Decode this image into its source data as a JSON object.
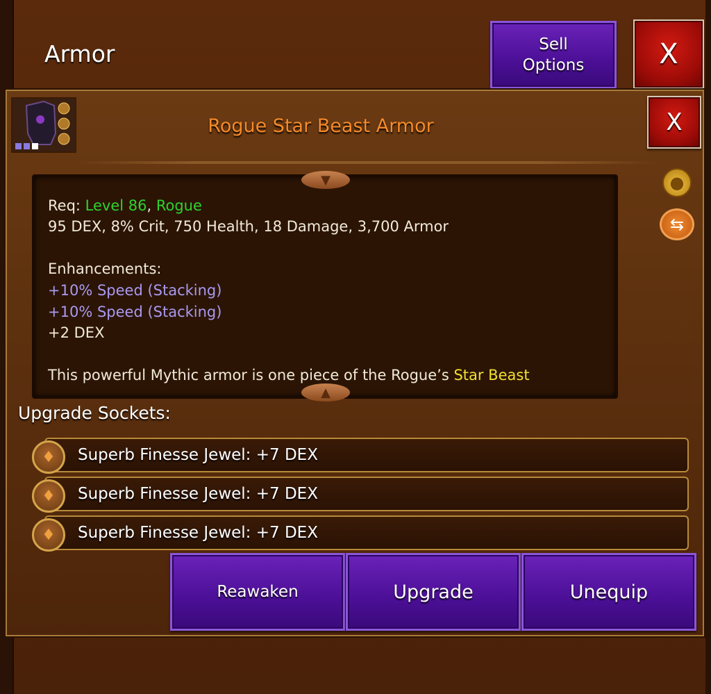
{
  "window": {
    "title": "Armor",
    "sell_options_label": "Sell\nOptions",
    "close_label": "X"
  },
  "item": {
    "name": "Rogue Star Beast Armor",
    "close_label": "X",
    "req_prefix": "Req: ",
    "req_level": "Level 86",
    "req_separator": ", ",
    "req_class": "Rogue",
    "stats": "95 DEX, 8% Crit, 750 Health, 18 Damage, 3,700 Armor",
    "enhancements_label": "Enhancements:",
    "enhancements": [
      {
        "text": "+10% Speed (Stacking)",
        "color": "#a89af0"
      },
      {
        "text": "+10% Speed (Stacking)",
        "color": "#a89af0"
      },
      {
        "text": "+2 DEX",
        "color": "#f2ead8"
      }
    ],
    "description_start": "This powerful Mythic armor is one piece of the Rogue’s ",
    "description_highlight": "Star Beast",
    "side_icons": [
      "coin-bag-icon",
      "swap-icon"
    ]
  },
  "sockets": {
    "label": "Upgrade Sockets:",
    "items": [
      {
        "text": "Superb Finesse Jewel: +7 DEX"
      },
      {
        "text": "Superb Finesse Jewel: +7 DEX"
      },
      {
        "text": "Superb Finesse Jewel: +7 DEX"
      }
    ]
  },
  "actions": {
    "reawaken": "Reawaken",
    "upgrade": "Upgrade",
    "unequip": "Unequip"
  },
  "colors": {
    "level_green": "#2fd22f",
    "title_orange": "#f58a2a",
    "highlight_yellow": "#f0e030",
    "enhancement_purple": "#a89af0",
    "button_purple": "#4b0f96",
    "close_red": "#b0100a"
  }
}
